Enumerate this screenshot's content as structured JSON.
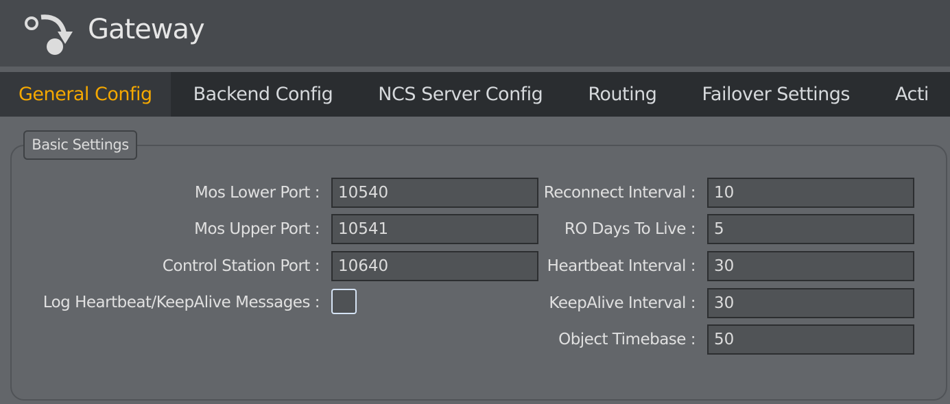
{
  "app": {
    "title": "Gateway",
    "accent": "#f5a800"
  },
  "tabs": [
    {
      "label": "General Config",
      "active": true
    },
    {
      "label": "Backend Config"
    },
    {
      "label": "NCS Server Config"
    },
    {
      "label": "Routing"
    },
    {
      "label": "Failover Settings"
    },
    {
      "label": "Acti"
    }
  ],
  "section": {
    "legend": "Basic Settings"
  },
  "left": [
    {
      "label": "Mos Lower Port :",
      "value": "10540"
    },
    {
      "label": "Mos Upper Port :",
      "value": "10541"
    },
    {
      "label": "Control Station Port :",
      "value": "10640"
    },
    {
      "label": "Log Heartbeat/KeepAlive Messages :",
      "checked": false
    }
  ],
  "right": [
    {
      "label": "Reconnect Interval :",
      "value": "10"
    },
    {
      "label": "RO Days To Live :",
      "value": "5"
    },
    {
      "label": "Heartbeat Interval :",
      "value": "30"
    },
    {
      "label": "KeepAlive Interval :",
      "value": "30"
    },
    {
      "label": "Object Timebase :",
      "value": "50"
    }
  ]
}
